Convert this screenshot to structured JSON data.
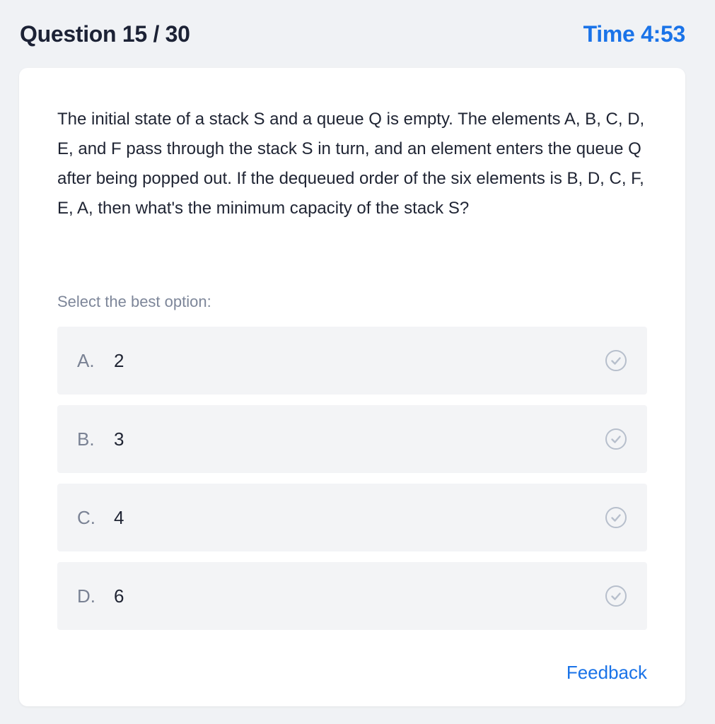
{
  "header": {
    "question_counter": "Question 15 / 30",
    "timer": "Time 4:53"
  },
  "question": {
    "text": "The initial state of a stack S and a queue Q is empty. The elements A, B, C, D, E, and F pass through the stack S in turn, and an element enters the queue Q after being popped out. If the dequeued order of the six elements is B, D, C, F, E, A, then what's the minimum capacity of the stack S?"
  },
  "prompt": "Select the best option:",
  "options": [
    {
      "letter": "A.",
      "value": "2"
    },
    {
      "letter": "B.",
      "value": "3"
    },
    {
      "letter": "C.",
      "value": "4"
    },
    {
      "letter": "D.",
      "value": "6"
    }
  ],
  "feedback_label": "Feedback",
  "colors": {
    "accent": "#1a73e8",
    "check_icon": "#b7bfcc"
  },
  "icons": {
    "option_check": "check-circle-icon"
  }
}
